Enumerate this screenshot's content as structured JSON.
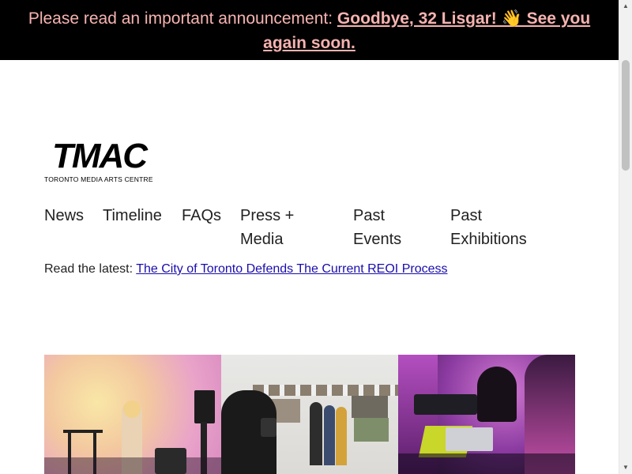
{
  "announcement": {
    "prefix": "Please read an important announcement: ",
    "link_text": "Goodbye, 32 Lisgar! 👋 See you again soon."
  },
  "logo": {
    "mark": "TMAC",
    "subtitle": "TORONTO MEDIA ARTS CENTRE"
  },
  "nav": {
    "items": [
      {
        "label": "News"
      },
      {
        "label": "Timeline"
      },
      {
        "label": "FAQs"
      },
      {
        "label": "Press + Media"
      },
      {
        "label": "Past Events"
      },
      {
        "label": "Past Exhibitions"
      }
    ]
  },
  "latest": {
    "prefix": "Read the latest: ",
    "link_text": "The City of Toronto Defends The Current REOI Process"
  },
  "colors": {
    "announcement_bg": "#000000",
    "announcement_text": "#f6b3b0",
    "link": "#1a0dab"
  }
}
